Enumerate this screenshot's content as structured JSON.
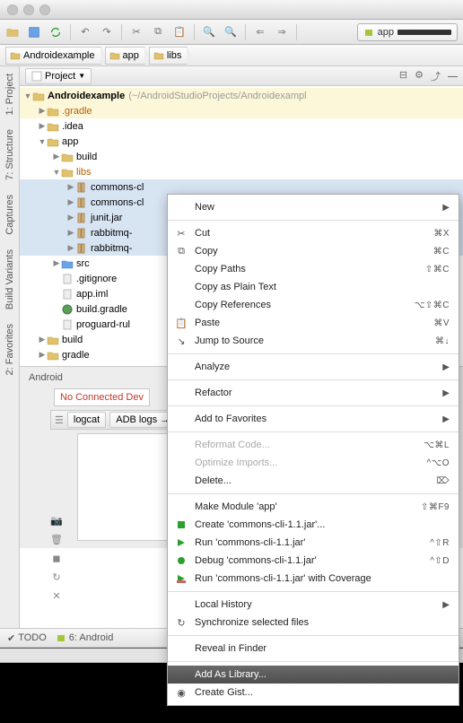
{
  "breadcrumbs": [
    "Androidexample",
    "app",
    "libs"
  ],
  "projectTool": {
    "label": "Project"
  },
  "tree": {
    "root": {
      "name": "Androidexample",
      "path": "(~/AndroidStudioProjects/Androidexampl"
    },
    "items": [
      {
        "name": ".gradle",
        "indent": 1,
        "type": "folder-orange",
        "arrow": "▶"
      },
      {
        "name": ".idea",
        "indent": 1,
        "type": "folder",
        "arrow": "▶"
      },
      {
        "name": "app",
        "indent": 1,
        "type": "folder",
        "arrow": "▼"
      },
      {
        "name": "build",
        "indent": 2,
        "type": "folder",
        "arrow": "▶"
      },
      {
        "name": "libs",
        "indent": 2,
        "type": "folder-orange",
        "arrow": "▼"
      },
      {
        "name": "commons-cl",
        "indent": 3,
        "type": "jar",
        "arrow": "▶",
        "sel": true
      },
      {
        "name": "commons-cl",
        "indent": 3,
        "type": "jar",
        "arrow": "▶",
        "sel": true
      },
      {
        "name": "junit.jar",
        "indent": 3,
        "type": "jar",
        "arrow": "▶",
        "sel": true
      },
      {
        "name": "rabbitmq-",
        "indent": 3,
        "type": "jar",
        "arrow": "▶",
        "sel": true
      },
      {
        "name": "rabbitmq-",
        "indent": 3,
        "type": "jar",
        "arrow": "▶",
        "sel": true
      },
      {
        "name": "src",
        "indent": 2,
        "type": "folder-blue",
        "arrow": "▶"
      },
      {
        "name": ".gitignore",
        "indent": 2,
        "type": "file",
        "arrow": ""
      },
      {
        "name": "app.iml",
        "indent": 2,
        "type": "file",
        "arrow": ""
      },
      {
        "name": "build.gradle",
        "indent": 2,
        "type": "gradle",
        "arrow": ""
      },
      {
        "name": "proguard-rul",
        "indent": 2,
        "type": "file",
        "arrow": ""
      },
      {
        "name": "build",
        "indent": 1,
        "type": "folder",
        "arrow": "▶"
      },
      {
        "name": "gradle",
        "indent": 1,
        "type": "folder",
        "arrow": "▶"
      }
    ]
  },
  "androidPanel": {
    "title": "Android",
    "notConnected": "No Connected Dev",
    "tabs": [
      "logcat",
      "ADB logs  →"
    ]
  },
  "sideTools": [
    "1: Project",
    "7: Structure",
    "Captures",
    "Build Variants",
    "2: Favorites"
  ],
  "bottomTabs": [
    "TODO",
    "6: Android"
  ],
  "runConfig": {
    "label": "app"
  },
  "contextMenu": {
    "items": [
      {
        "label": "New",
        "submenu": true
      },
      "---",
      {
        "icon": "cut",
        "label": "Cut",
        "shortcut": "⌘X"
      },
      {
        "icon": "copy",
        "label": "Copy",
        "shortcut": "⌘C"
      },
      {
        "label": "Copy Paths",
        "shortcut": "⇧⌘C"
      },
      {
        "label": "Copy as Plain Text"
      },
      {
        "label": "Copy References",
        "shortcut": "⌥⇧⌘C"
      },
      {
        "icon": "paste",
        "label": "Paste",
        "shortcut": "⌘V"
      },
      {
        "icon": "jump",
        "label": "Jump to Source",
        "shortcut": "⌘↓"
      },
      "---",
      {
        "label": "Analyze",
        "submenu": true
      },
      "---",
      {
        "label": "Refactor",
        "submenu": true
      },
      "---",
      {
        "label": "Add to Favorites",
        "submenu": true
      },
      "---",
      {
        "label": "Reformat Code...",
        "shortcut": "⌥⌘L",
        "disabled": true
      },
      {
        "label": "Optimize Imports...",
        "shortcut": "^⌥O",
        "disabled": true
      },
      {
        "label": "Delete...",
        "shortcut": "⌦"
      },
      "---",
      {
        "label": "Make Module 'app'",
        "shortcut": "⇧⌘F9"
      },
      {
        "icon": "green",
        "label": "Create 'commons-cli-1.1.jar'..."
      },
      {
        "icon": "play",
        "label": "Run 'commons-cli-1.1.jar'",
        "shortcut": "^⇧R"
      },
      {
        "icon": "bug",
        "label": "Debug 'commons-cli-1.1.jar'",
        "shortcut": "^⇧D"
      },
      {
        "icon": "coverage",
        "label": "Run 'commons-cli-1.1.jar' with Coverage"
      },
      "---",
      {
        "label": "Local History",
        "submenu": true
      },
      {
        "icon": "sync",
        "label": "Synchronize selected files"
      },
      "---",
      {
        "label": "Reveal in Finder"
      },
      "---",
      {
        "label": "Add As Library...",
        "highlighted": true
      },
      {
        "icon": "gist",
        "label": "Create Gist..."
      }
    ]
  }
}
